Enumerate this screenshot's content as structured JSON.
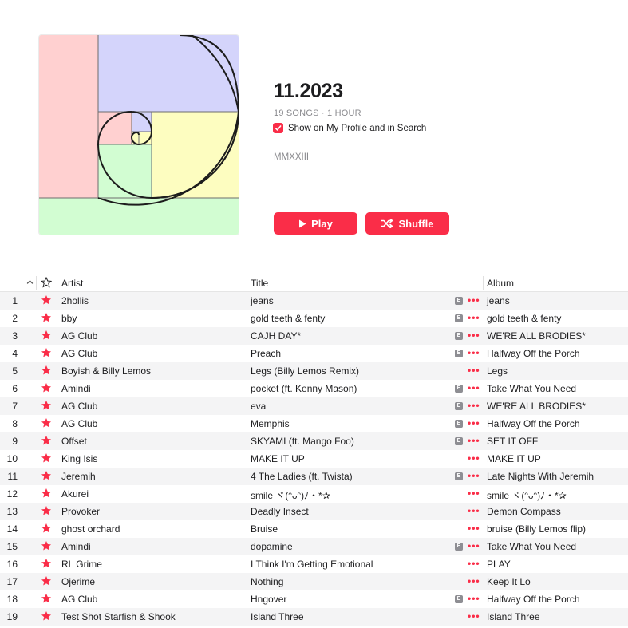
{
  "playlist": {
    "title": "11.2023",
    "meta": "19 SONGS · 1 HOUR",
    "profile_label": "Show on My Profile and in Search",
    "profile_checked": true,
    "description": "MMXXIII"
  },
  "buttons": {
    "play_label": "Play",
    "shuffle_label": "Shuffle"
  },
  "colors": {
    "accent": "#fa2d48",
    "art_pink": "#ffd0d0",
    "art_lavender": "#d4d4fb",
    "art_yellow": "#fdfdc0",
    "art_green": "#d2fdd2"
  },
  "table": {
    "headers": {
      "artist": "Artist",
      "title": "Title",
      "album": "Album",
      "sort_icon": "chevron-up-icon",
      "favorite_icon": "star-outline-icon"
    },
    "rows": [
      {
        "num": "1",
        "artist": "2hollis",
        "title": "jeans",
        "explicit": true,
        "album": "jeans"
      },
      {
        "num": "2",
        "artist": "bby",
        "title": "gold teeth & fenty",
        "explicit": true,
        "album": "gold teeth & fenty"
      },
      {
        "num": "3",
        "artist": "AG Club",
        "title": "CAJH DAY*",
        "explicit": true,
        "album": "WE'RE ALL BRODIES*"
      },
      {
        "num": "4",
        "artist": "AG Club",
        "title": "Preach",
        "explicit": true,
        "album": "Halfway Off the Porch"
      },
      {
        "num": "5",
        "artist": "Boyish & Billy Lemos",
        "title": "Legs (Billy Lemos Remix)",
        "explicit": false,
        "album": "Legs"
      },
      {
        "num": "6",
        "artist": "Amindi",
        "title": "pocket (ft. Kenny Mason)",
        "explicit": true,
        "album": "Take What You Need"
      },
      {
        "num": "7",
        "artist": "AG Club",
        "title": "eva",
        "explicit": true,
        "album": "WE'RE ALL BRODIES*"
      },
      {
        "num": "8",
        "artist": "AG Club",
        "title": "Memphis",
        "explicit": true,
        "album": "Halfway Off the Porch"
      },
      {
        "num": "9",
        "artist": "Offset",
        "title": "SKYAMI (ft. Mango Foo)",
        "explicit": true,
        "album": "SET IT OFF"
      },
      {
        "num": "10",
        "artist": "King Isis",
        "title": "MAKE IT UP",
        "explicit": false,
        "album": "MAKE IT UP"
      },
      {
        "num": "11",
        "artist": "Jeremih",
        "title": "4 The Ladies (ft. Twista)",
        "explicit": true,
        "album": "Late Nights With Jeremih"
      },
      {
        "num": "12",
        "artist": "Akurei",
        "title": "smile ヾ(ᵔᴗᵔ)ﾉ・*✰",
        "explicit": false,
        "album": "smile ヾ(ᵔᴗᵔ)ﾉ・*✰"
      },
      {
        "num": "13",
        "artist": "Provoker",
        "title": "Deadly Insect",
        "explicit": false,
        "album": "Demon Compass"
      },
      {
        "num": "14",
        "artist": "ghost orchard",
        "title": "Bruise",
        "explicit": false,
        "album": "bruise (Billy Lemos flip)"
      },
      {
        "num": "15",
        "artist": "Amindi",
        "title": "dopamine",
        "explicit": true,
        "album": "Take What You Need"
      },
      {
        "num": "16",
        "artist": "RL Grime",
        "title": "I Think I'm Getting Emotional",
        "explicit": false,
        "album": "PLAY"
      },
      {
        "num": "17",
        "artist": "Ojerime",
        "title": "Nothing",
        "explicit": false,
        "album": "Keep It Lo"
      },
      {
        "num": "18",
        "artist": "AG Club",
        "title": "Hngover",
        "explicit": true,
        "album": "Halfway Off the Porch"
      },
      {
        "num": "19",
        "artist": "Test Shot Starfish & Shook",
        "title": "Island Three",
        "explicit": false,
        "album": "Island Three"
      }
    ],
    "explicit_badge": "E",
    "row_icons": {
      "favorite": "star-filled-icon",
      "more": "more-dots-icon"
    }
  }
}
